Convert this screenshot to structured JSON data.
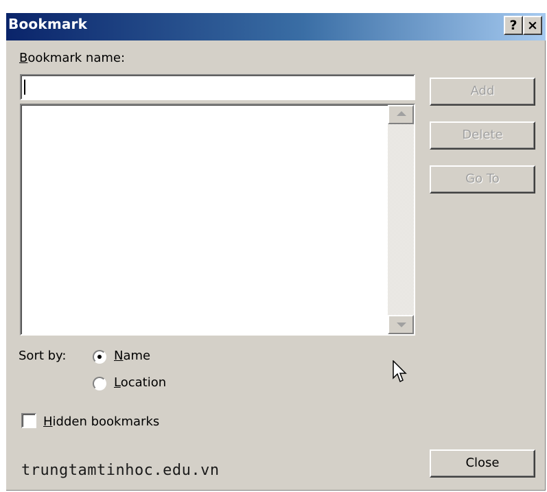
{
  "window": {
    "title": "Bookmark",
    "help_glyph": "?",
    "close_glyph": "×"
  },
  "bookmark_name": {
    "label_underlined": "B",
    "label_rest": "ookmark name:",
    "value": ""
  },
  "bookmark_list": {
    "items": []
  },
  "buttons": {
    "add": "Add",
    "delete": "Delete",
    "goto": "Go To",
    "close": "Close"
  },
  "sort": {
    "label": "Sort by:",
    "name_underlined": "N",
    "name_rest": "ame",
    "location_underlined": "L",
    "location_rest": "ocation",
    "selected": "Name"
  },
  "hidden_bookmarks": {
    "underlined": "H",
    "rest": "idden bookmarks",
    "checked": false
  },
  "watermark": "trungtamtinhoc.edu.vn",
  "icons": {
    "mouse_cursor": "arrow-pointer-icon"
  }
}
